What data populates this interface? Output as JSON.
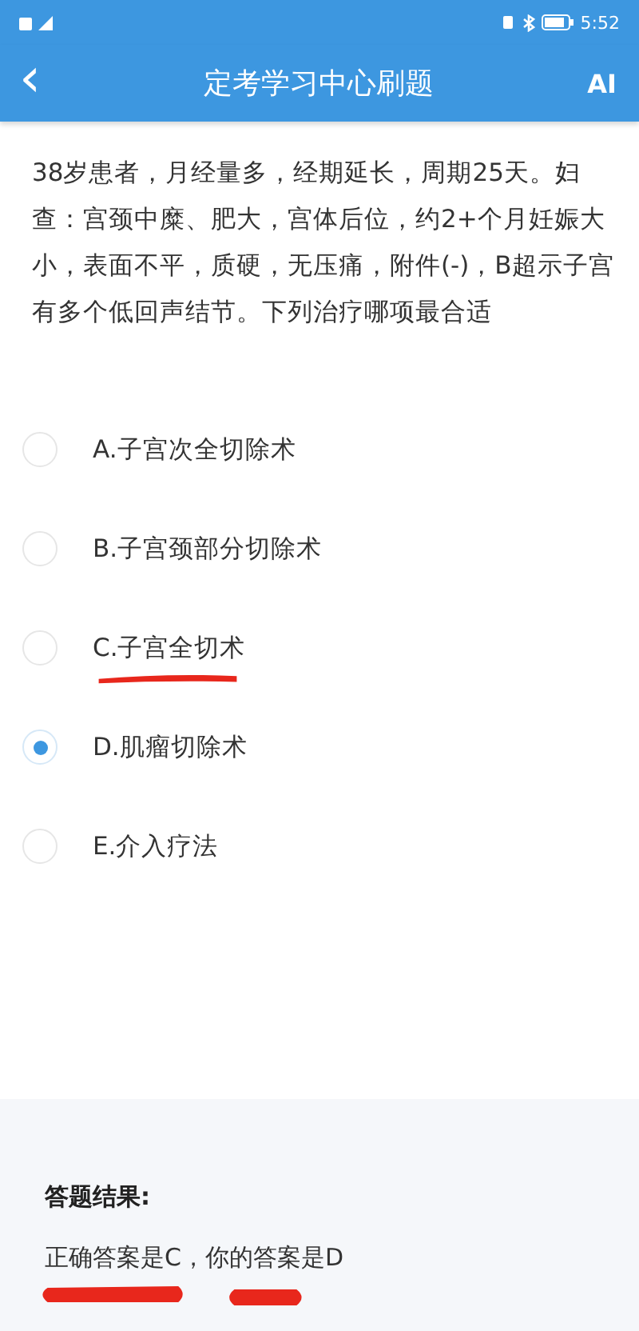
{
  "status_bar": {
    "time": "5:52"
  },
  "header": {
    "back": "‹",
    "title": "定考学习中心刷题",
    "ai_button": "AI"
  },
  "question": {
    "text": "38岁患者，月经量多，经期延长，周期25天。妇查：宫颈中糜、肥大，宫体后位，约2+个月妊娠大小，表面不平，质硬，无压痛，附件(-)，B超示子宫有多个低回声结节。下列治疗哪项最合适"
  },
  "options": [
    {
      "label": "A.子宫次全切除术",
      "selected": false,
      "marked": false
    },
    {
      "label": "B.子宫颈部分切除术",
      "selected": false,
      "marked": false
    },
    {
      "label": "C.子宫全切术",
      "selected": false,
      "marked": true
    },
    {
      "label": "D.肌瘤切除术",
      "selected": true,
      "marked": false
    },
    {
      "label": "E.介入疗法",
      "selected": false,
      "marked": false
    }
  ],
  "result": {
    "heading": "答题结果:",
    "text": "正确答案是C，你的答案是D",
    "marked": true
  }
}
